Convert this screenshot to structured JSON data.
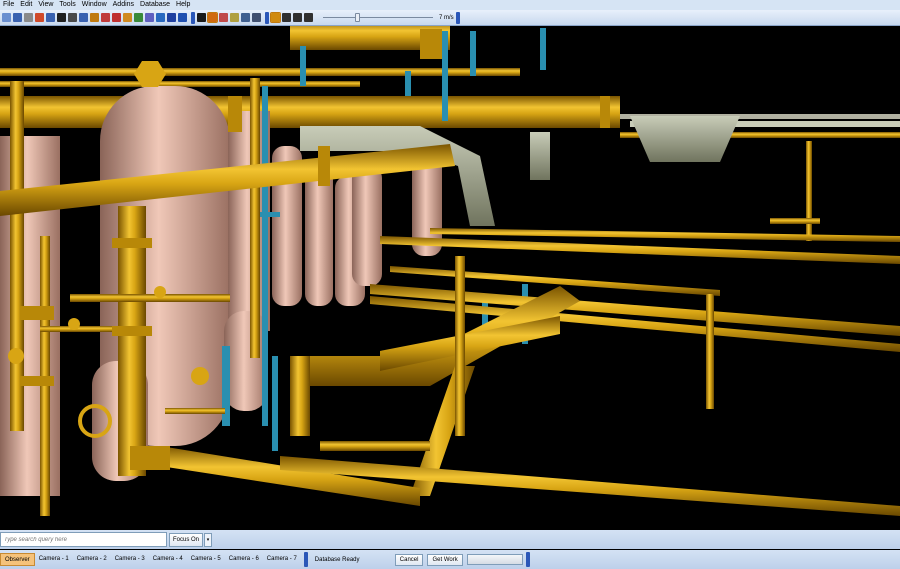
{
  "menu": {
    "items": [
      "File",
      "Edit",
      "View",
      "Tools",
      "Window",
      "Addins",
      "Database",
      "Help"
    ]
  },
  "toolbar": {
    "icons": [
      {
        "name": "new-icon",
        "color": "#6a8fd0"
      },
      {
        "name": "save-icon",
        "color": "#3a62b0"
      },
      {
        "name": "print-icon",
        "color": "#8a8a8a"
      },
      {
        "name": "model-icon",
        "color": "#d04a2a"
      },
      {
        "name": "zoom-icon",
        "color": "#3a62b0"
      },
      {
        "name": "select-icon",
        "color": "#202020"
      },
      {
        "name": "box-icon",
        "color": "#4a4a4a"
      },
      {
        "name": "move-icon",
        "color": "#3a62b0"
      },
      {
        "name": "scale-icon",
        "color": "#c07a10"
      },
      {
        "name": "edit-icon",
        "color": "#c03a3a"
      },
      {
        "name": "target-icon",
        "color": "#c03030"
      },
      {
        "name": "layers-icon",
        "color": "#d08a20"
      },
      {
        "name": "clip-icon",
        "color": "#3a8a3a"
      },
      {
        "name": "measure-icon",
        "color": "#6060c0"
      },
      {
        "name": "annotate-icon",
        "color": "#2a6ac0"
      },
      {
        "name": "link-icon",
        "color": "#2040a0"
      },
      {
        "name": "grid-icon",
        "color": "#2050b0"
      }
    ],
    "view_icons": [
      {
        "name": "observer-icon",
        "color": "#1a1a1a"
      },
      {
        "name": "walk-icon",
        "color": "#d06a10",
        "active": true
      },
      {
        "name": "fly-icon",
        "color": "#c04a4a"
      },
      {
        "name": "window-icon",
        "color": "#b0a040"
      },
      {
        "name": "split-icon",
        "color": "#406090"
      },
      {
        "name": "panel-icon",
        "color": "#405070"
      }
    ],
    "nav_icons": [
      {
        "name": "gravity-icon",
        "color": "#d08a10",
        "active": true
      },
      {
        "name": "rotate-icon",
        "color": "#303030"
      },
      {
        "name": "pan-icon",
        "color": "#303030"
      },
      {
        "name": "orbit-icon",
        "color": "#303030"
      }
    ],
    "speed": {
      "value_fraction": 0.3,
      "label": "7 m/s"
    }
  },
  "search": {
    "placeholder": "Type search query here",
    "focus_label": "Focus On",
    "dropdown_glyph": "▾"
  },
  "status": {
    "cameras": [
      {
        "label": "Observer",
        "active": true
      },
      {
        "label": "Camera - 1"
      },
      {
        "label": "Camera - 2"
      },
      {
        "label": "Camera - 3"
      },
      {
        "label": "Camera - 4"
      },
      {
        "label": "Camera - 5"
      },
      {
        "label": "Camera - 6"
      },
      {
        "label": "Camera - 7"
      }
    ],
    "db_status": "Database Ready",
    "cancel_label": "Cancel",
    "get_work_label": "Get Work"
  },
  "colors": {
    "pipe": "#d8a514",
    "pipe_dark": "#a37408",
    "vessel": "#e2b7a8",
    "steel": "#2a8fb0",
    "duct": "#9aa08a"
  }
}
